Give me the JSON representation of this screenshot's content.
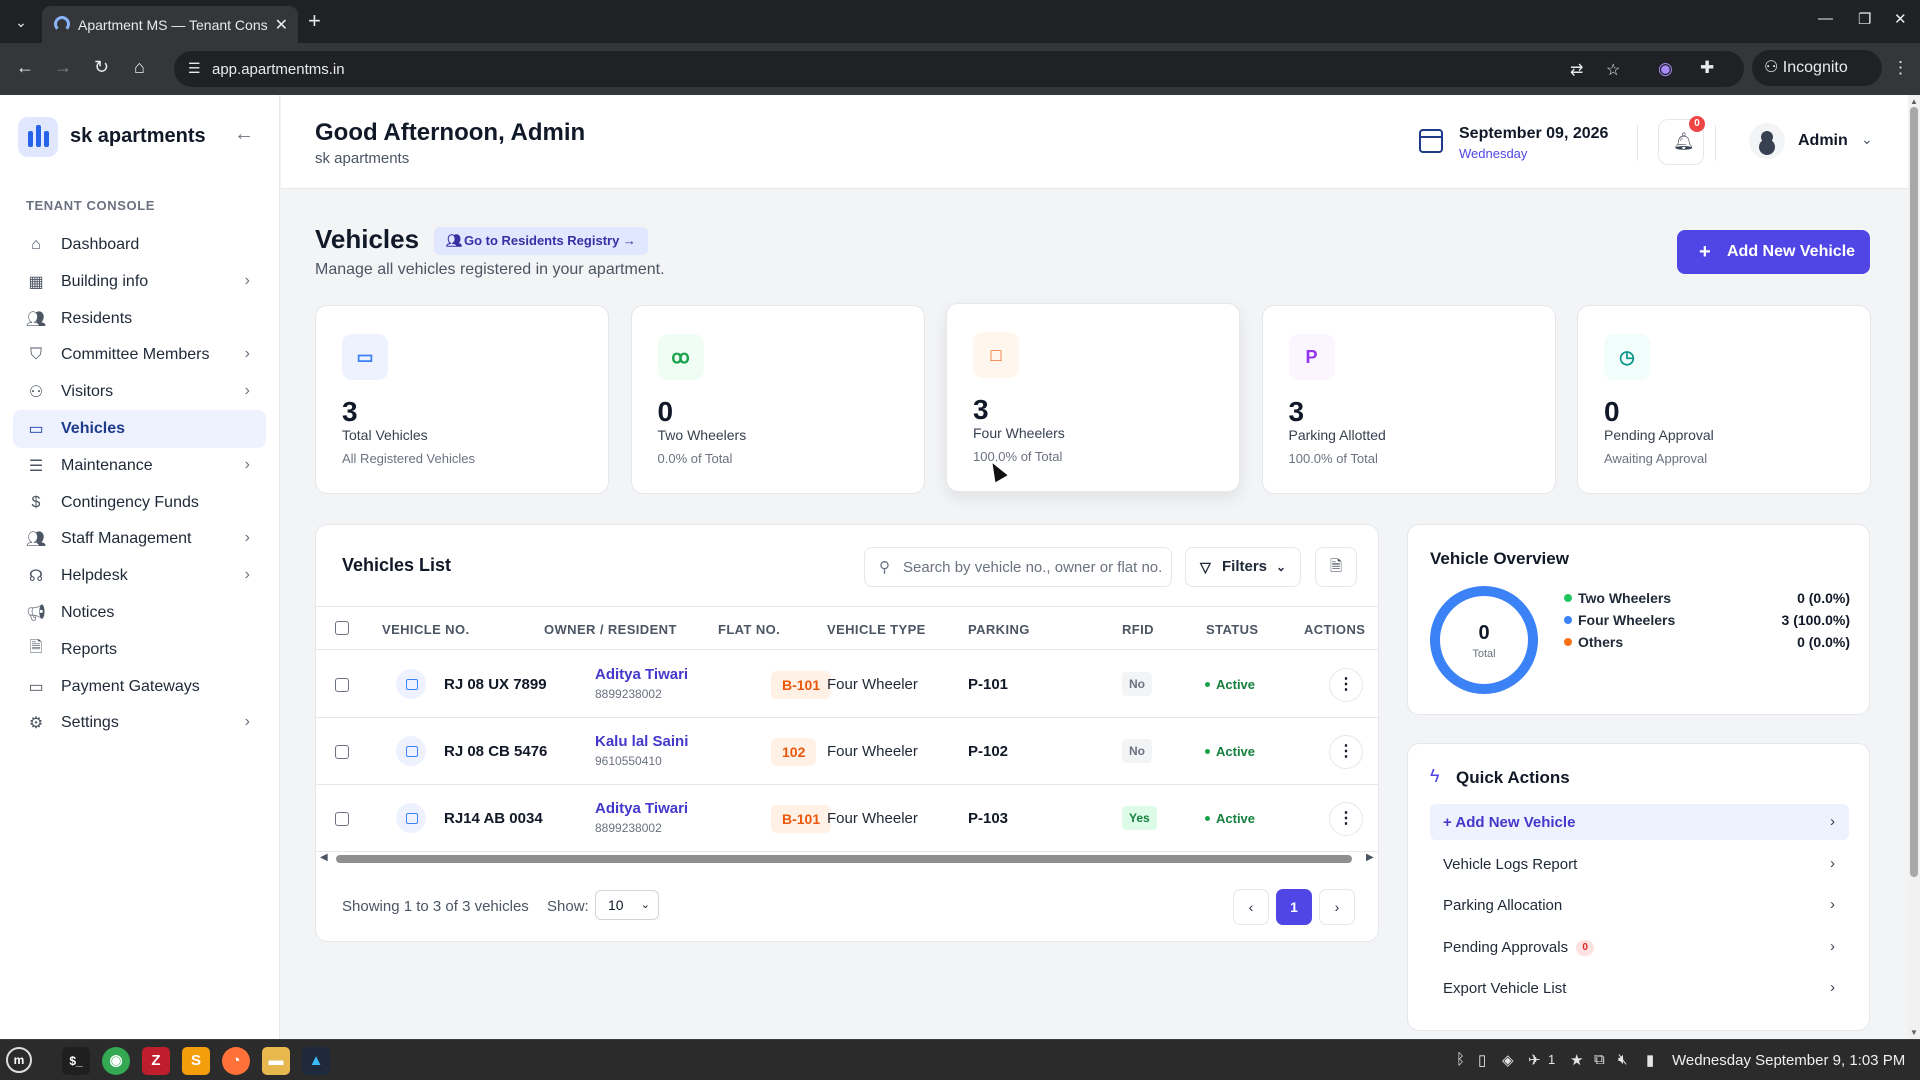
{
  "browser": {
    "tab_title": "Apartment MS — Tenant Console",
    "url": "app.apartmentms.in",
    "incognito_label": "Incognito"
  },
  "sidebar": {
    "brand": "sk apartments",
    "section_label": "TENANT CONSOLE",
    "items": [
      {
        "label": "Dashboard",
        "icon": "home-icon",
        "chevron": false,
        "active": false
      },
      {
        "label": "Building info",
        "icon": "grid-icon",
        "chevron": true,
        "active": false
      },
      {
        "label": "Residents",
        "icon": "users-icon",
        "chevron": false,
        "active": false
      },
      {
        "label": "Committee Members",
        "icon": "shield-icon",
        "chevron": true,
        "active": false
      },
      {
        "label": "Visitors",
        "icon": "user-plus-icon",
        "chevron": true,
        "active": false
      },
      {
        "label": "Vehicles",
        "icon": "car-icon",
        "chevron": false,
        "active": true
      },
      {
        "label": "Maintenance",
        "icon": "server-icon",
        "chevron": true,
        "active": false
      },
      {
        "label": "Contingency Funds",
        "icon": "dollar-icon",
        "chevron": false,
        "active": false
      },
      {
        "label": "Staff Management",
        "icon": "users-icon",
        "chevron": true,
        "active": false
      },
      {
        "label": "Helpdesk",
        "icon": "headset-icon",
        "chevron": true,
        "active": false
      },
      {
        "label": "Notices",
        "icon": "megaphone-icon",
        "chevron": false,
        "active": false
      },
      {
        "label": "Reports",
        "icon": "file-icon",
        "chevron": false,
        "active": false
      },
      {
        "label": "Payment Gateways",
        "icon": "credit-card-icon",
        "chevron": false,
        "active": false
      },
      {
        "label": "Settings",
        "icon": "gear-icon",
        "chevron": true,
        "active": false
      }
    ]
  },
  "header": {
    "greeting": "Good Afternoon, Admin",
    "subtitle": "sk apartments",
    "date": "September 09, 2026",
    "weekday": "Wednesday",
    "notification_count": "0",
    "user": "Admin"
  },
  "page": {
    "title": "Vehicles",
    "registry_link": "Go to Residents Registry →",
    "subtitle": "Manage all vehicles registered in your apartment.",
    "add_button": "Add New Vehicle"
  },
  "stats": [
    {
      "value": "3",
      "label": "Total Vehicles",
      "note": "All Registered Vehicles",
      "icon": "car-icon",
      "icon_text": "▭",
      "bg": "#eef2ff",
      "fg": "#3b82f6"
    },
    {
      "value": "0",
      "label": "Two Wheelers",
      "note": "0.0% of Total",
      "icon": "bike-icon",
      "icon_text": "ꝏ",
      "bg": "#f0fdf4",
      "fg": "#16a34a"
    },
    {
      "value": "3",
      "label": "Four Wheelers",
      "note": "100.0% of Total",
      "icon": "car-icon",
      "icon_text": "□",
      "bg": "#fff7ed",
      "fg": "#ea580c"
    },
    {
      "value": "3",
      "label": "Parking Allotted",
      "note": "100.0% of Total",
      "icon": "parking-icon",
      "icon_text": "P",
      "bg": "#faf5ff",
      "fg": "#9333ea"
    },
    {
      "value": "0",
      "label": "Pending Approval",
      "note": "Awaiting Approval",
      "icon": "clock-icon",
      "icon_text": "◷",
      "bg": "#f0fdfa",
      "fg": "#0d9488"
    }
  ],
  "vehicles_list": {
    "title": "Vehicles List",
    "search_placeholder": "Search by vehicle no., owner or flat no.",
    "filters_label": "Filters",
    "columns": [
      "VEHICLE NO.",
      "OWNER / RESIDENT",
      "FLAT NO.",
      "VEHICLE TYPE",
      "PARKING",
      "RFID",
      "STATUS",
      "ACTIONS"
    ],
    "rows": [
      {
        "vehicle_no": "RJ 08 UX 7899",
        "owner": "Aditya Tiwari",
        "phone": "8899238002",
        "flat": "B-101",
        "type": "Four Wheeler",
        "parking": "P-101",
        "rfid": "No",
        "status": "Active"
      },
      {
        "vehicle_no": "RJ 08 CB 5476",
        "owner": "Kalu lal Saini",
        "phone": "9610550410",
        "flat": "102",
        "type": "Four Wheeler",
        "parking": "P-102",
        "rfid": "No",
        "status": "Active"
      },
      {
        "vehicle_no": "RJ14 AB 0034",
        "owner": "Aditya Tiwari",
        "phone": "8899238002",
        "flat": "B-101",
        "type": "Four Wheeler",
        "parking": "P-103",
        "rfid": "Yes",
        "status": "Active"
      }
    ],
    "showing": "Showing 1 to 3 of 3 vehicles",
    "show_label": "Show:",
    "page_size": "10",
    "current_page": "1"
  },
  "overview": {
    "title": "Vehicle Overview",
    "total_value": "0",
    "total_label": "Total",
    "legend": [
      {
        "name": "Two Wheelers",
        "value": "0 (0.0%)",
        "color": "#22c55e"
      },
      {
        "name": "Four Wheelers",
        "value": "3 (100.0%)",
        "color": "#3b82f6"
      },
      {
        "name": "Others",
        "value": "0 (0.0%)",
        "color": "#f97316"
      }
    ]
  },
  "quick_actions": {
    "title": "Quick Actions",
    "items": [
      {
        "label": "+ Add New Vehicle",
        "count": null
      },
      {
        "label": "Vehicle Logs Report",
        "count": null
      },
      {
        "label": "Parking Allocation",
        "count": null
      },
      {
        "label": "Pending Approvals",
        "count": "0"
      },
      {
        "label": "Export Vehicle List",
        "count": null
      }
    ]
  },
  "taskbar": {
    "clock": "Wednesday September 9, 1:03 PM",
    "volume_level": "1"
  }
}
